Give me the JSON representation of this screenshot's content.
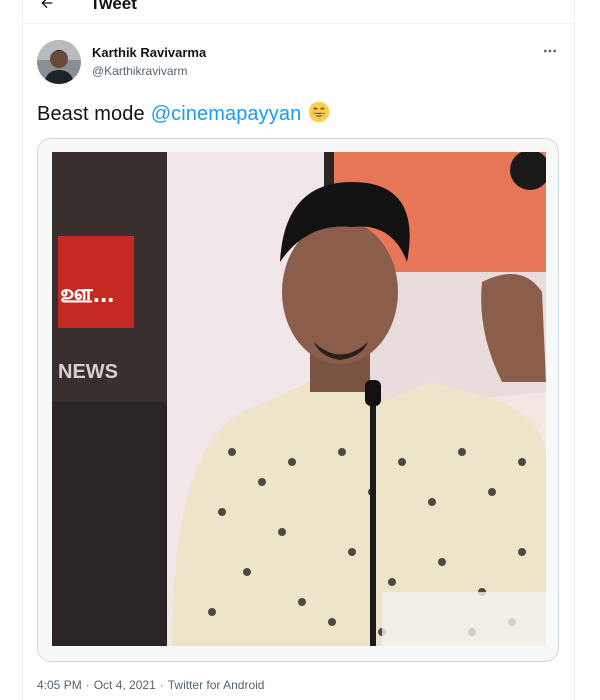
{
  "header": {
    "back_icon": "back-arrow-icon",
    "title": "Tweet"
  },
  "tweet": {
    "author_name": "Karthik Ravivarma",
    "author_handle": "@Karthikravivarm",
    "more_icon": "more-horizontal-icon",
    "text_prefix": "Beast mode",
    "mention": "@cinemapayyan",
    "emoji_icon": "grinning-face-emoji-icon",
    "media": {
      "backdrop_logo_text": "ஊ...",
      "backdrop_news_text": "NEWS"
    },
    "time": "4:05 PM",
    "separator": "·",
    "date": "Oct 4, 2021",
    "source": "Twitter for Android"
  },
  "colors": {
    "accent": "#1d9bf0",
    "text": "#0f1419",
    "secondary": "#536471"
  }
}
